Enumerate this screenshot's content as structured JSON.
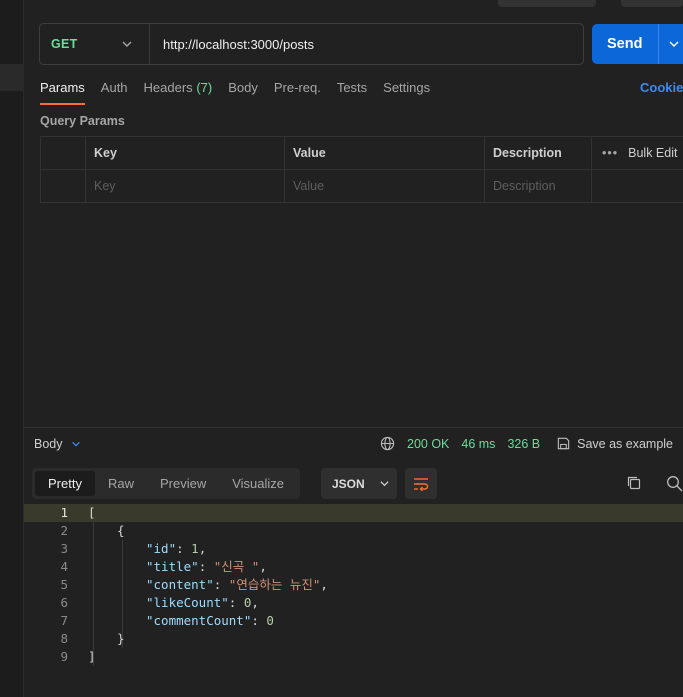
{
  "request": {
    "method": "GET",
    "url": "http://localhost:3000/posts",
    "send_label": "Send"
  },
  "request_tabs": [
    {
      "label": "Params",
      "active": true
    },
    {
      "label": "Auth"
    },
    {
      "label": "Headers",
      "count": "(7)"
    },
    {
      "label": "Body"
    },
    {
      "label": "Pre-req."
    },
    {
      "label": "Tests"
    },
    {
      "label": "Settings"
    }
  ],
  "cookies_label": "Cookies",
  "query_params": {
    "title": "Query Params",
    "headers": {
      "key": "Key",
      "value": "Value",
      "description": "Description"
    },
    "bulk_edit": "Bulk Edit",
    "placeholders": {
      "key": "Key",
      "value": "Value",
      "description": "Description"
    }
  },
  "response": {
    "body_label": "Body",
    "status": "200 OK",
    "time": "46 ms",
    "size": "326 B",
    "save_example": "Save as example",
    "view_tabs": [
      "Pretty",
      "Raw",
      "Preview",
      "Visualize"
    ],
    "active_view": "Pretty",
    "format": "JSON",
    "lines": [
      "1",
      "2",
      "3",
      "4",
      "5",
      "6",
      "7",
      "8",
      "9"
    ],
    "json": {
      "open_bracket": "[",
      "open_brace": "{",
      "id_key": "\"id\"",
      "id_val": "1",
      "title_key": "\"title\"",
      "title_val": "\"신곡 \"",
      "content_key": "\"content\"",
      "content_val": "\"연습하는 뉴진\"",
      "likeCount_key": "\"likeCount\"",
      "likeCount_val": "0",
      "commentCount_key": "\"commentCount\"",
      "commentCount_val": "0",
      "close_brace": "}",
      "close_bracket": "]"
    }
  },
  "colors": {
    "accent": "#ff6c37",
    "send": "#0c68d8",
    "method": "#6bdd9a",
    "status": "#6bdd9a",
    "link": "#3d8bf0"
  }
}
